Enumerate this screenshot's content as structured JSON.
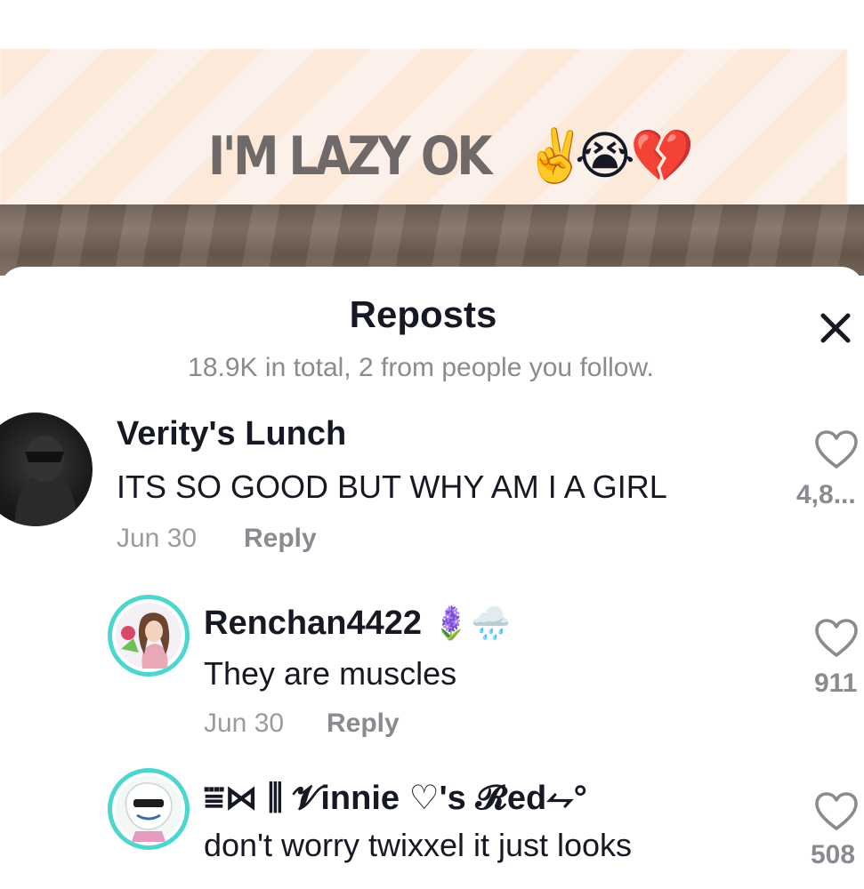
{
  "video": {
    "overlay_text": "I'M LAZY OK",
    "overlay_emojis": [
      "✌️",
      "😭",
      "💔"
    ]
  },
  "sheet": {
    "title": "Reposts",
    "subtitle": "18.9K in total, 2 from people you follow.",
    "close_icon": "close-icon"
  },
  "comments": [
    {
      "username": "Verity's Lunch",
      "text": "ITS SO GOOD BUT WHY AM I A GIRL",
      "date": "Jun 30",
      "reply_label": "Reply",
      "like_count": "4,8..."
    },
    {
      "username": "Renchan4422",
      "username_emojis": "🪻🌧️",
      "text": "They are muscles",
      "date": "Jun 30",
      "reply_label": "Reply",
      "like_count": "911"
    },
    {
      "username": "⩸⋈ ⫼ 𝓥innie ♡'s 𝓡ed⥊°",
      "text": "don't worry twixxel it just looks",
      "like_count": "508"
    }
  ],
  "colors": {
    "text_primary": "#161823",
    "text_secondary": "#8a8b91",
    "avatar_ring": "#4dd6cf"
  }
}
